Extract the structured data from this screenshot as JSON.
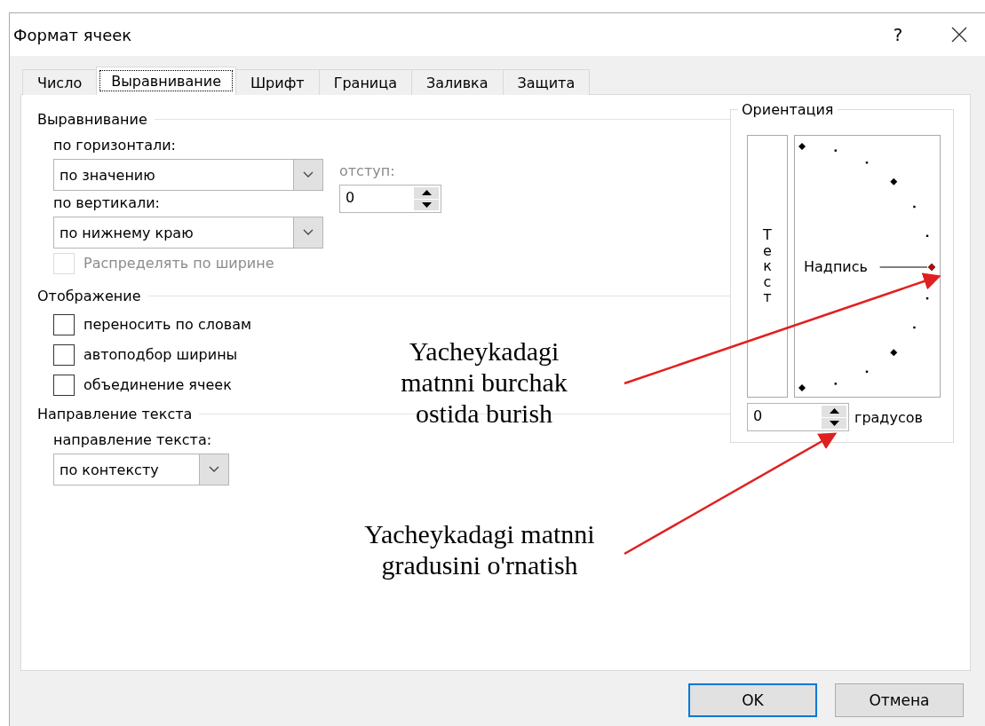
{
  "window": {
    "title": "Формат ячеек",
    "help": "?"
  },
  "tabs": [
    {
      "label": "Число",
      "selected": false
    },
    {
      "label": "Выравнивание",
      "selected": true
    },
    {
      "label": "Шрифт",
      "selected": false
    },
    {
      "label": "Граница",
      "selected": false
    },
    {
      "label": "Заливка",
      "selected": false
    },
    {
      "label": "Защита",
      "selected": false
    }
  ],
  "alignment": {
    "title": "Выравнивание",
    "horizontal": {
      "label": "по горизонтали:",
      "value": "по значению"
    },
    "vertical": {
      "label": "по вертикали:",
      "value": "по нижнему краю"
    },
    "indent": {
      "label": "отступ:",
      "value": "0",
      "disabled": true
    },
    "distributed": {
      "label": "Распределять по ширине",
      "checked": false,
      "disabled": true
    }
  },
  "display": {
    "title": "Отображение",
    "options": [
      {
        "label": "переносить по словам",
        "checked": false
      },
      {
        "label": "автоподбор ширины",
        "checked": false
      },
      {
        "label": "объединение ячеек",
        "checked": false
      }
    ]
  },
  "direction": {
    "title": "Направление текста",
    "label": "направление текста:",
    "value": "по контексту"
  },
  "orientation": {
    "title": "Ориентация",
    "vertical_text": "Текст",
    "dial_label": "Надпись",
    "degrees": {
      "value": "0",
      "unit": "градусов"
    }
  },
  "annotations": [
    {
      "text": "Yacheykadagi matnni burchak ostida burish"
    },
    {
      "text": "Yacheykadagi matnni gradusini o'rnatish"
    }
  ],
  "buttons": [
    {
      "label": "OK",
      "default": true
    },
    {
      "label": "Отмена",
      "default": false
    }
  ]
}
